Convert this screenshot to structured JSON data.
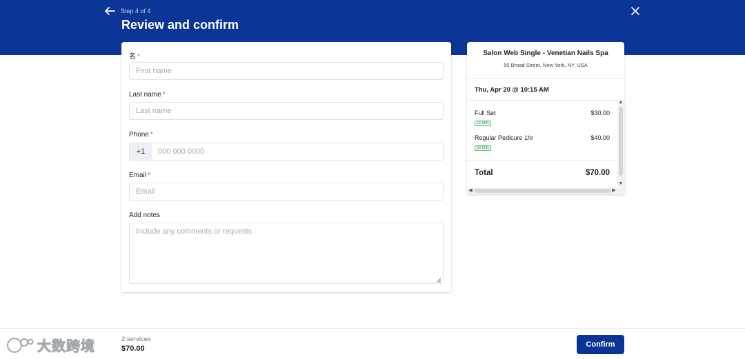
{
  "header": {
    "step": "Step 4 of 4",
    "title": "Review and confirm",
    "accent_color": "#0a3597",
    "back_icon": "arrow-left-icon",
    "close_icon": "close-icon"
  },
  "form": {
    "first_name": {
      "label": "名",
      "required": "*",
      "placeholder": "First name",
      "value": ""
    },
    "last_name": {
      "label": "Last name",
      "required": "*",
      "placeholder": "Last name",
      "value": ""
    },
    "phone": {
      "label": "Phone",
      "required": "*",
      "prefix": "+1",
      "placeholder": "000 000 0000",
      "value": ""
    },
    "email": {
      "label": "Email",
      "required": "*",
      "placeholder": "Email",
      "value": ""
    },
    "notes": {
      "label": "Add notes",
      "placeholder": "Include any comments or requests",
      "value": ""
    }
  },
  "summary": {
    "salon_name": "Salon Web Single - Venetian Nails Spa",
    "address": "50 Broad Street, New York, NY, USA",
    "datetime": "Thu, Apr 20 @ 10:15 AM",
    "services": [
      {
        "name": "Full Set",
        "price": "$30.00",
        "duration": "15 MIN"
      },
      {
        "name": "Regular Pedicure 1hr",
        "price": "$40.00",
        "duration": "60 MIN"
      }
    ],
    "total_label": "Total",
    "total_value": "$70.00"
  },
  "footer": {
    "service_count": "2 services",
    "total": "$70.00",
    "confirm_label": "Confirm"
  },
  "watermark": {
    "text": "大数跨境"
  }
}
